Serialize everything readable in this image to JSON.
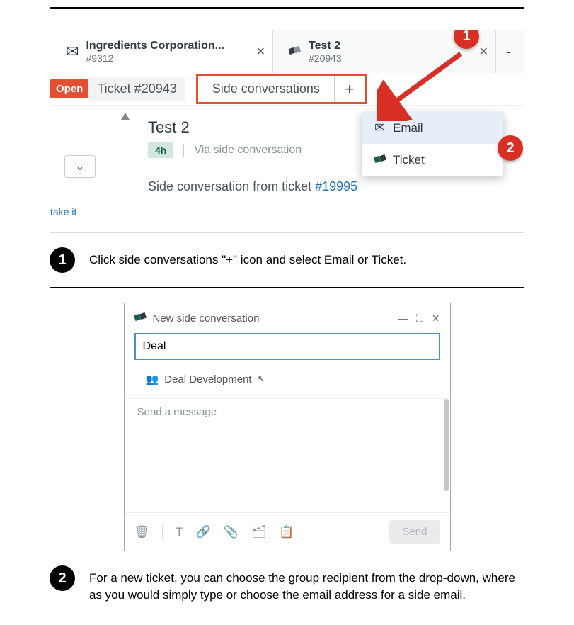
{
  "tabs": [
    {
      "title": "Ingredients Corporation...",
      "num": "#9312"
    },
    {
      "title": "Test 2",
      "num": "#20943"
    }
  ],
  "open_label": "Open",
  "ticket_label": "Ticket #20943",
  "sideconv_label": "Side conversations",
  "plus": "+",
  "dropdown": {
    "email": "Email",
    "ticket": "Ticket"
  },
  "subject": "Test 2",
  "time_badge": "4h",
  "via": "Via side conversation",
  "from_prefix": "Side conversation from ticket ",
  "from_link": "#19995",
  "take_it": "take it",
  "step1": "Click side conversations \"+\" icon and select Email or Ticket.",
  "nsc_title": "New side conversation",
  "input_value": "Deal",
  "suggestion": "Deal Development",
  "msg_placeholder": "Send a message",
  "send": "Send",
  "step2": "For a new ticket, you can choose the group recipient from the drop-down, where as you would simply type or choose the email address for a side email."
}
